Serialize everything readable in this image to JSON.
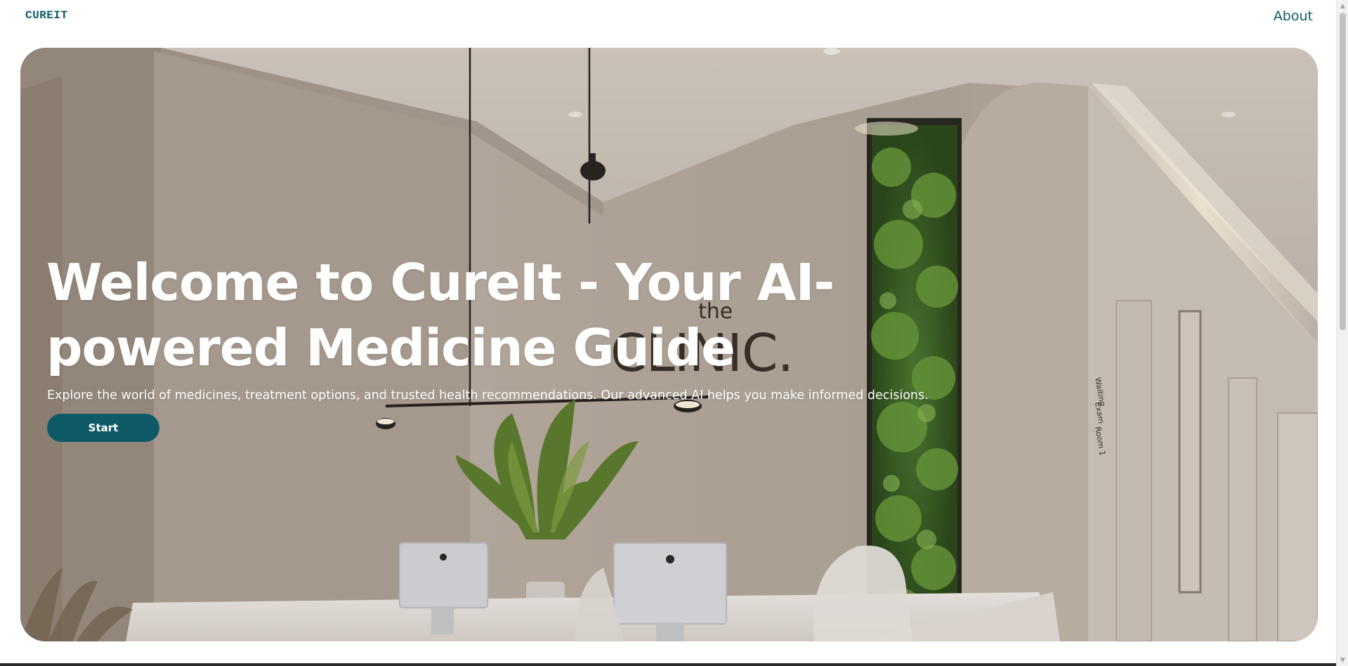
{
  "header": {
    "brand": "CUREIT",
    "nav": [
      {
        "label": "About"
      }
    ]
  },
  "hero": {
    "title_line1": "Welcome to CureIt - Your AI-",
    "title_line2": "powered Medicine Guide",
    "subtitle": "Explore the world of medicines, treatment options, and trusted health recommendations. Our advanced AI helps you make informed decisions.",
    "cta_label": "Start",
    "background_sign_text": "CLINIC.",
    "background_sign_small": "the"
  },
  "colors": {
    "brand": "#0d5a66",
    "hero_text": "#ffffff",
    "wall": "#b6aa9f"
  },
  "icons": {
    "scroll_up": "triangle-up",
    "scroll_down": "triangle-down"
  }
}
